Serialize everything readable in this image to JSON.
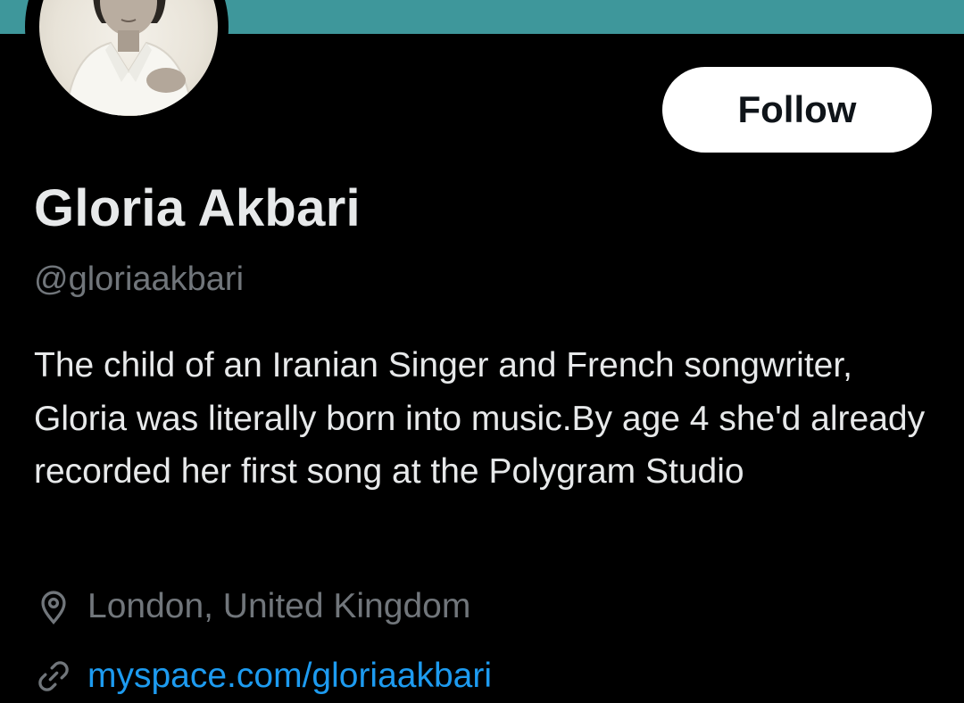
{
  "profile": {
    "display_name": "Gloria Akbari",
    "handle": "@gloriaakbari",
    "bio": "The child of an Iranian Singer and French songwriter, Gloria was literally born into music.By age 4 she'd already recorded her first song at the Polygram Studio",
    "location": "London, United Kingdom",
    "website": "myspace.com/gloriaakbari",
    "avatar_icon": "profile-photo"
  },
  "actions": {
    "follow_label": "Follow"
  },
  "icons": {
    "location": "map-pin-icon",
    "website": "link-icon"
  },
  "colors": {
    "banner": "#3e979b",
    "background": "#000000",
    "primary_text": "#e7e9ea",
    "secondary_text": "#71767b",
    "link": "#1d9bf0",
    "button_bg": "#ffffff",
    "button_text": "#0f1419"
  }
}
